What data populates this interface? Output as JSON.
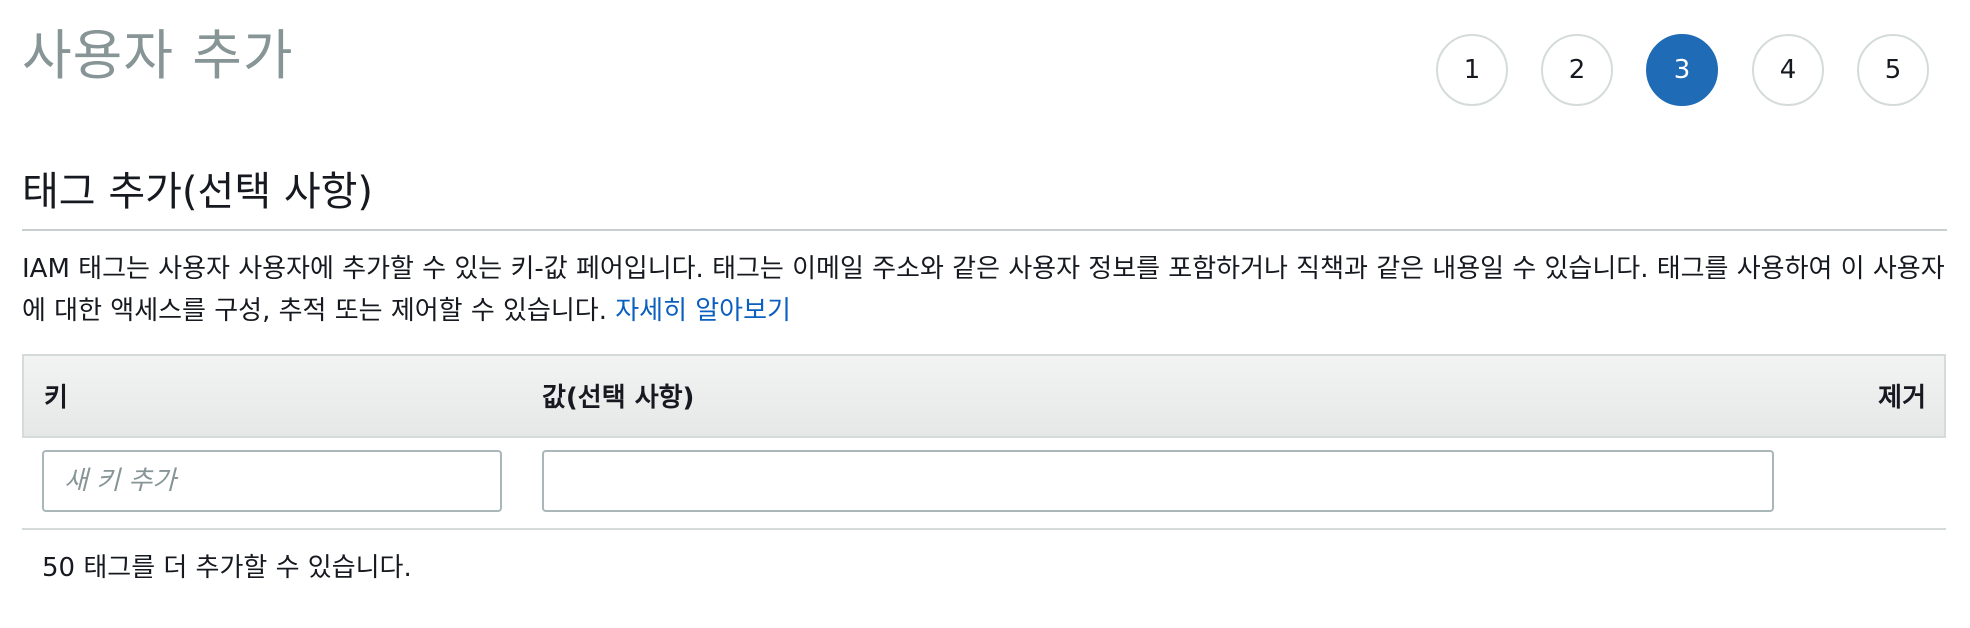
{
  "page": {
    "title": "사용자 추가"
  },
  "steps": [
    {
      "label": "1",
      "active": false
    },
    {
      "label": "2",
      "active": false
    },
    {
      "label": "3",
      "active": true
    },
    {
      "label": "4",
      "active": false
    },
    {
      "label": "5",
      "active": false
    }
  ],
  "section": {
    "title": "태그 추가(선택 사항)",
    "description": "IAM 태그는 사용자 사용자에 추가할 수 있는 키-값 페어입니다. 태그는 이메일 주소와 같은 사용자 정보를 포함하거나 직책과 같은 내용일 수 있습니다. 태그를 사용하여 이 사용자에 대한 액세스를 구성, 추적 또는 제어할 수 있습니다.",
    "learn_more": "자세히 알아보기"
  },
  "tag_table": {
    "headers": {
      "key": "키",
      "value": "값(선택 사항)",
      "remove": "제거"
    },
    "row": {
      "key_placeholder": "새 키 추가",
      "key_value": "",
      "value_value": ""
    }
  },
  "footer": {
    "remaining_note": "50 태그를 더 추가할 수 있습니다."
  },
  "colors": {
    "accent": "#1f6bb5",
    "link": "#0a5fbf",
    "title_gray": "#879596"
  }
}
